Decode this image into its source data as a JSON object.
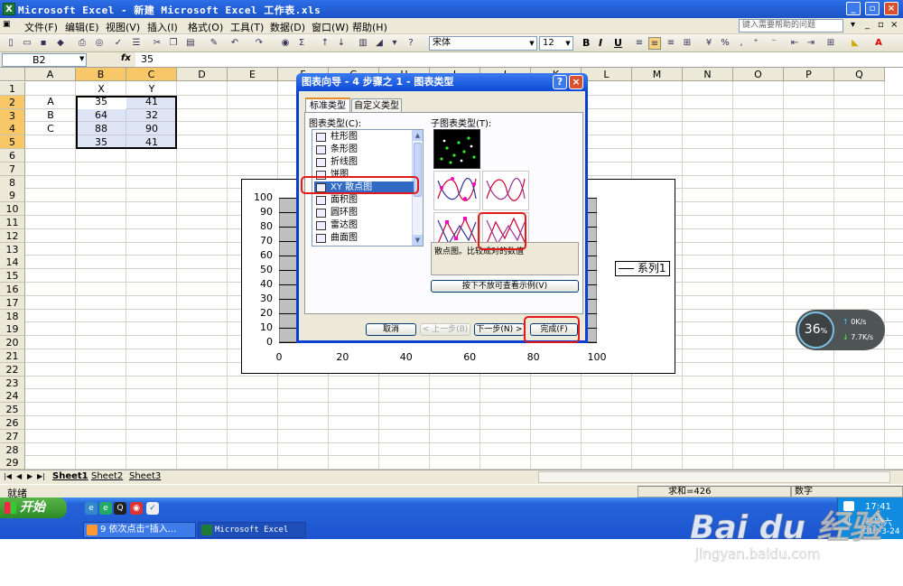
{
  "window": {
    "title": "Microsoft Excel - 新建 Microsoft Excel 工作表.xls"
  },
  "menu": {
    "items": [
      "文件(F)",
      "编辑(E)",
      "视图(V)",
      "插入(I)",
      "格式(O)",
      "工具(T)",
      "数据(D)",
      "窗口(W)",
      "帮助(H)"
    ],
    "help_placeholder": "键入需要帮助的问题"
  },
  "toolbar": {
    "font_name": "宋体",
    "font_size": "12",
    "bold": "B",
    "italic": "I",
    "underline": "U",
    "sigma": "Σ"
  },
  "formula_bar": {
    "name_box": "B2",
    "fx": "fx",
    "value": "35"
  },
  "grid": {
    "columns": [
      "A",
      "B",
      "C",
      "D",
      "E",
      "F",
      "G",
      "H",
      "I",
      "J",
      "K",
      "L",
      "M",
      "N",
      "O",
      "P",
      "Q"
    ],
    "rows": [
      "1",
      "2",
      "3",
      "4",
      "5",
      "6",
      "7",
      "8",
      "9",
      "10",
      "11",
      "12",
      "13",
      "14",
      "15",
      "16",
      "17",
      "18",
      "19",
      "20",
      "21",
      "22",
      "23",
      "24",
      "25",
      "26",
      "27",
      "28",
      "29"
    ],
    "cells": [
      {
        "ref": "B1",
        "v": "X"
      },
      {
        "ref": "C1",
        "v": "Y"
      },
      {
        "ref": "A2",
        "v": "A"
      },
      {
        "ref": "B2",
        "v": "35"
      },
      {
        "ref": "C2",
        "v": "41"
      },
      {
        "ref": "A3",
        "v": "B"
      },
      {
        "ref": "B3",
        "v": "64"
      },
      {
        "ref": "C3",
        "v": "32"
      },
      {
        "ref": "A4",
        "v": "C"
      },
      {
        "ref": "B4",
        "v": "88"
      },
      {
        "ref": "C4",
        "v": "90"
      },
      {
        "ref": "B5",
        "v": "35"
      },
      {
        "ref": "C5",
        "v": "41"
      }
    ]
  },
  "chart_data": {
    "type": "scatter",
    "x_ticks": [
      "0",
      "20",
      "40",
      "60",
      "80",
      "100"
    ],
    "y_ticks": [
      "100",
      "90",
      "80",
      "70",
      "60",
      "50",
      "40",
      "30",
      "20",
      "10",
      "0"
    ],
    "xlim": [
      0,
      100
    ],
    "ylim": [
      0,
      100
    ],
    "legend": "系列1",
    "legend_position": "right"
  },
  "dialog": {
    "title": "图表向导 - 4 步骤之 1 - 图表类型",
    "help_btn": "?",
    "close_btn": "×",
    "tabs": [
      "标准类型",
      "自定义类型"
    ],
    "chart_type_label": "图表类型(C):",
    "chart_types": [
      {
        "label": "柱形图",
        "icon": "column-chart-icon"
      },
      {
        "label": "条形图",
        "icon": "bar-chart-icon"
      },
      {
        "label": "折线图",
        "icon": "line-chart-icon"
      },
      {
        "label": "饼图",
        "icon": "pie-chart-icon"
      },
      {
        "label": "XY 散点图",
        "icon": "scatter-chart-icon",
        "selected": true
      },
      {
        "label": "面积图",
        "icon": "area-chart-icon"
      },
      {
        "label": "圆环图",
        "icon": "doughnut-chart-icon"
      },
      {
        "label": "雷达图",
        "icon": "radar-chart-icon"
      },
      {
        "label": "曲面图",
        "icon": "surface-chart-icon"
      }
    ],
    "subtype_label": "子图表类型(T):",
    "description": "散点图。比较成对的数值",
    "preview_btn": "按下不放可查看示例(V)",
    "cancel_btn": "取消",
    "back_btn": "< 上一步(B)",
    "next_btn": "下一步(N) >",
    "finish_btn": "完成(F)"
  },
  "sheets": [
    "Sheet1",
    "Sheet2",
    "Sheet3"
  ],
  "status": {
    "ready": "就绪",
    "sum": "求和=426",
    "mode": "数字"
  },
  "taskbar": {
    "start": "开始",
    "tasks": [
      "9 依次点击“插入...",
      "Microsoft Excel ..."
    ],
    "time": "17:41",
    "weekday": "星期六",
    "date": "2018-3-24"
  },
  "net_widget": {
    "percent": "36",
    "percent_unit": "%",
    "up": "0K/s",
    "down": "7.7K/s"
  },
  "watermark": {
    "logo": "Bai du 经验",
    "url": "jingyan.baidu.com"
  }
}
